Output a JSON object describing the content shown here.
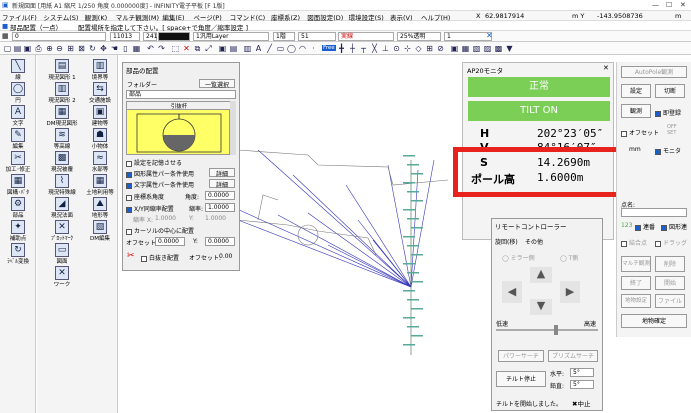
{
  "title": {
    "text": "新規図面 [用紙 A1 縮尺 1/250 角度 0.000000度] - INFINITY電子平板 [F 1版]",
    "minimize": "—",
    "maximize": "☐",
    "close": "✕"
  },
  "menu": [
    "ファイル(F)",
    "システム(S)",
    "観測(K)",
    "マルチ観測(M)",
    "編集(E)",
    "ページ(P)",
    "コマンド(C)",
    "座標系(Z)",
    "図面設定(D)",
    "環境設定(S)",
    "表示(V)",
    "ヘルプ(H)"
  ],
  "coords": {
    "x_label": "X",
    "x_value": "62.9817914",
    "y_label": "m  Y",
    "y_value": "-143.9508736",
    "unit": "m"
  },
  "command": {
    "tag": "部品配置（一点）",
    "prompt": "配置場所を指定して下さい。[ space+で角度／縮率設定 ]"
  },
  "toolbar": {
    "layer_no": "0",
    "code": "11013",
    "code2": "241",
    "layer_name": "1汎用Layer",
    "floor": "1階",
    "line_no": "51",
    "line_type": "実線",
    "transparency": "25%透明",
    "weight": "1",
    "free": "Free"
  },
  "tools": [
    {
      "label": "線",
      "icon": "╲"
    },
    {
      "label": "円",
      "icon": "◯"
    },
    {
      "label": "文字",
      "icon": "A"
    },
    {
      "label": "編集",
      "icon": "✎"
    },
    {
      "label": "加工･修正",
      "icon": "✂"
    },
    {
      "label": "図構･ﾊﾟﾀ",
      "icon": "▦"
    },
    {
      "label": "部品",
      "icon": "⚙"
    },
    {
      "label": "補助点",
      "icon": "✦"
    },
    {
      "label": "ﾗﾍﾞﾙ変換",
      "icon": "↻"
    }
  ],
  "tools2": [
    {
      "label": "現況図形 1",
      "icon": "▤"
    },
    {
      "label": "現況図形 2",
      "icon": "▥"
    },
    {
      "label": "DM現況図形",
      "icon": "▦"
    },
    {
      "label": "等高線",
      "icon": "≋"
    },
    {
      "label": "現況被覆",
      "icon": "▩"
    },
    {
      "label": "現況特殊線",
      "icon": "⌇"
    },
    {
      "label": "現況法面",
      "icon": "◢"
    },
    {
      "label": "ﾌﾟﾛｯﾄﾏｰｸ",
      "icon": "✕"
    },
    {
      "label": "図面",
      "icon": "▭"
    },
    {
      "label": "ワーク",
      "icon": "✕"
    }
  ],
  "tools3": [
    {
      "label": "境界等",
      "icon": "▥"
    },
    {
      "label": "交通施設",
      "icon": "⇆"
    },
    {
      "label": "建物等",
      "icon": "▣"
    },
    {
      "label": "小物体",
      "icon": "☗"
    },
    {
      "label": "水部等",
      "icon": "≈"
    },
    {
      "label": "土地利用等",
      "icon": "▦"
    },
    {
      "label": "地形等",
      "icon": "⛰"
    },
    {
      "label": "DM編集",
      "icon": "▧"
    }
  ],
  "parts": {
    "title": "部品の配置",
    "folder_label": "フォルダー",
    "list_button": "一覧選択",
    "category": "部品",
    "preview_title": "引抜杆",
    "remember": "設定を記憶させる",
    "graphic_attr": "図形属性パー条件使用",
    "text_attr": "文字属性パー条件使用",
    "coord_angle": "座標系角度",
    "angle_label": "角度:",
    "angle_value": "0.0000",
    "xy_scale": "X/Y同縮率配置",
    "scale_label": "縮率:",
    "scale_value": "1.0000",
    "scale_x_label": "縮率 X:",
    "scale_x": "1.0000",
    "scale_y_label": "Y:",
    "scale_y": "1.0000",
    "cursor_center": "カーソルの中心に配置",
    "offset_label": "オフセット:",
    "offset_x": "0.0000",
    "offset_y_label": "Y:",
    "offset_y": "0.0000",
    "attr_btn": "詳細",
    "auto_place": "白抜き配置",
    "offset2_label": "オフセット:",
    "offset2": "0.00"
  },
  "monitor": {
    "title": "AP20モニタ",
    "status": "正常",
    "tilt": "TILT ON",
    "rows": [
      {
        "label": "H",
        "value": "202°23′05″"
      },
      {
        "label": "V",
        "value": "84°16′07″"
      },
      {
        "label": "S",
        "value": "14.2690m"
      },
      {
        "label": "ポール高",
        "value": "1.6000m"
      }
    ]
  },
  "remote": {
    "title": "リモートコントローラー",
    "tabs": [
      "旋回(移)",
      "その他"
    ],
    "mirror": "ミラー側",
    "t_side": "T側",
    "slow": "低速",
    "fast": "高速",
    "power_search": "パワーサーチ",
    "prism_search": "プリズムサーチ",
    "tilt_stop": "チルト停止",
    "horizontal": "水平:",
    "h_val": "5°",
    "vertical": "鉛直:",
    "v_val": "5°",
    "status_msg": "チルトを開始しました。",
    "cancel": "中止"
  },
  "right_panel": {
    "autopole": "AutoPole観測",
    "settings": "設定",
    "switch": "切断",
    "observe": "観測",
    "register": "即登録",
    "offset": "オフセット",
    "offset_set": "OFF SET",
    "unit_mm": "mm",
    "monitor": "モニタ",
    "point_name_label": "点名:",
    "continuous": "連番",
    "figure_link": "図形連",
    "combine": "結合点",
    "drag": "ドラッグ",
    "multi_obs": "マルチ観測",
    "delete": "削除",
    "end": "終了",
    "start": "開始",
    "undo_disp": "地物設定",
    "file": "ファイル",
    "confirm": "地物確定",
    "code_no": "123"
  },
  "colors": {
    "accent": "#1a5fd0",
    "green": "#7bcf57",
    "highlight": "#e8221c",
    "yellow": "#ffff66"
  }
}
